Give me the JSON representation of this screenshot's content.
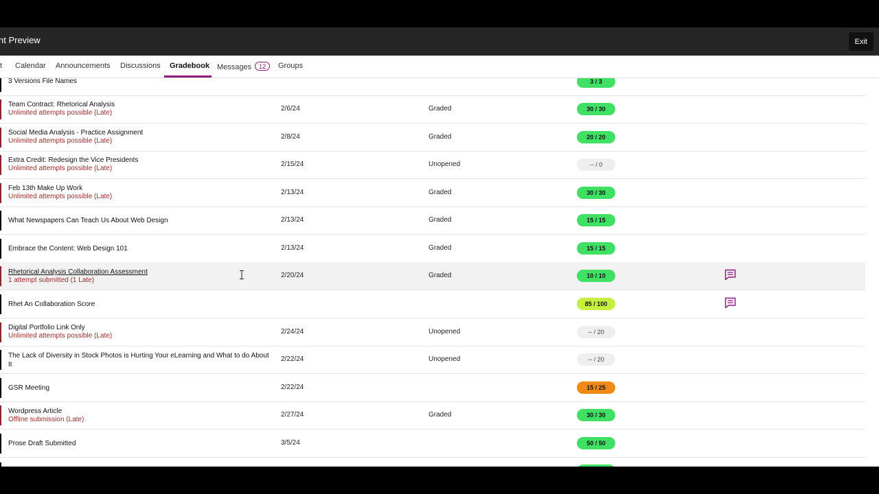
{
  "header": {
    "title": "nt Preview",
    "exit_label": "Exit"
  },
  "nav": {
    "tabs": [
      {
        "label": "t"
      },
      {
        "label": "Calendar"
      },
      {
        "label": "Announcements"
      },
      {
        "label": "Discussions"
      },
      {
        "label": "Gradebook",
        "active": true
      },
      {
        "label": "Messages",
        "badge": "12"
      },
      {
        "label": "Groups"
      }
    ]
  },
  "rows": [
    {
      "name": "3 Versions File Names",
      "sub": "",
      "due": "",
      "status": "",
      "grade": "3 / 3"
    },
    {
      "name": "Team Contract: Rhetorical Analysis",
      "sub": "Unlimited attempts possible (Late)",
      "due": "2/6/24",
      "status": "Graded",
      "grade": "30 / 30"
    },
    {
      "name": "Social Media Analysis - Practice Assignment",
      "sub": "Unlimited attempts possible (Late)",
      "due": "2/8/24",
      "status": "Graded",
      "grade": "20 / 20"
    },
    {
      "name": "Extra Credit: Redesign the Vice Presidents",
      "sub": "Unlimited attempts possible (Late)",
      "due": "2/15/24",
      "status": "Unopened",
      "grade": "-- / 0"
    },
    {
      "name": "Feb 13th Make Up Work",
      "sub": "Unlimited attempts possible (Late)",
      "due": "2/13/24",
      "status": "Graded",
      "grade": "30 / 30"
    },
    {
      "name": "What Newspapers Can Teach Us About Web Design",
      "sub": "",
      "due": "2/13/24",
      "status": "Graded",
      "grade": "15 / 15"
    },
    {
      "name": "Embrace the Content: Web Design 101",
      "sub": "",
      "due": "2/13/24",
      "status": "Graded",
      "grade": "15 / 15"
    },
    {
      "name": "Rhetorical Analysis Collaboration Assessment",
      "sub": "1 attempt submitted (1 Late)",
      "due": "2/20/24",
      "status": "Graded",
      "grade": "10 / 10"
    },
    {
      "name": "Rhet An Collaboration Score",
      "sub": "",
      "due": "",
      "status": "",
      "grade": "85 / 100"
    },
    {
      "name": "Digital Portfolio Link Only",
      "sub": "Unlimited attempts possible (Late)",
      "due": "2/24/24",
      "status": "Unopened",
      "grade": "-- / 20"
    },
    {
      "name": "The Lack of Diversity in Stock Photos is Hurting Your eLearning and What to do About It",
      "sub": "",
      "due": "2/22/24",
      "status": "Unopened",
      "grade": "-- / 20"
    },
    {
      "name": "GSR Meeting",
      "sub": "",
      "due": "2/22/24",
      "status": "",
      "grade": "15 / 25"
    },
    {
      "name": "Wordpress Article",
      "sub": "Offline submission (Late)",
      "due": "2/27/24",
      "status": "Graded",
      "grade": "30 / 30"
    },
    {
      "name": "Prose Draft Submitted",
      "sub": "",
      "due": "3/5/24",
      "status": "",
      "grade": "50 / 50"
    }
  ],
  "colors": {
    "accent": "#8b1d7b",
    "late": "#9a2a2a",
    "full_grade": "#3fe063",
    "partial_grade": "#c6ee40",
    "low_grade": "#f08a16",
    "no_grade": "#eeeeee"
  },
  "icons": {
    "feedback": "feedback-chat-icon",
    "cursor": "text-cursor-icon"
  }
}
